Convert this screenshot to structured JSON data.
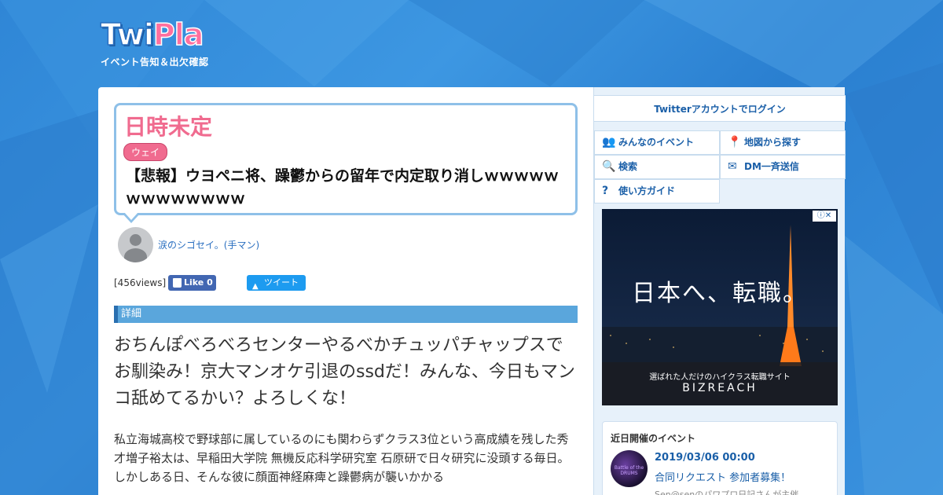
{
  "logo": {
    "twi": "Twi",
    "pla": "Pla",
    "subtitle": "イベント告知＆出欠確認"
  },
  "event": {
    "date": "日時未定",
    "tag": "ウェイ",
    "title": "【悲報】ウヨペニ将、躁鬱からの留年で内定取り消しｗｗｗｗｗｗｗｗｗｗｗｗｗ",
    "host": "涙のシゴセイ。(手マン)",
    "views": "[456views]",
    "like_label": "Like 0",
    "tweet_label": "ツイート",
    "section": "詳細",
    "lead": "おちんぽべろべろセンターやるべかチュッパチャップスでお馴染み！京大マンオケ引退のssdだ！みんな、今日もマンコ舐めてるかい？よろしくな！",
    "body": "私立海城高校で野球部に属しているのにも関わらずクラス3位という高成績を残した秀才増子裕太は、早稲田大学院 無機反応科学研究室 石原研で日々研究に没頭する毎日。しかしある日、そんな彼に顔面神経麻痺と躁鬱病が襲いかかる"
  },
  "sidebar": {
    "login": "Twitterアカウントでログイン",
    "nav": [
      {
        "label": "みんなのイベント",
        "icon": "users-icon"
      },
      {
        "label": "地図から探す",
        "icon": "map-pin-icon"
      },
      {
        "label": "検索",
        "icon": "search-icon"
      },
      {
        "label": "DM一斉送信",
        "icon": "mail-icon"
      },
      {
        "label": "使い方ガイド",
        "icon": "question-icon"
      }
    ],
    "ad": {
      "title": "日本へ、転職。",
      "caption": "選ばれた人だけのハイクラス転職サイト",
      "brand": "BIZREACH"
    },
    "upcoming": {
      "heading": "近日開催のイベント",
      "date": "2019/03/06 00:00",
      "name": "合同リクエスト 参加者募集！",
      "host": "Sen@senのパワプロ日記さんが主催",
      "thumb_text": "Battle of the DRUMS"
    }
  },
  "colors": {
    "background": "#2f86d6",
    "accent_pink": "#f06b8f",
    "link_blue": "#1a5fa8",
    "section_blue": "#5aa6dc"
  }
}
